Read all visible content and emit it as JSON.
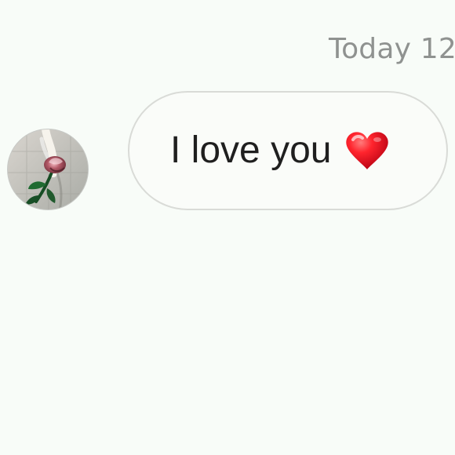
{
  "chat": {
    "timestamp": "Today 12",
    "messages": [
      {
        "text": "I love you",
        "reaction_icon": "red-heart-icon",
        "avatar_icon": "rose-avatar-icon"
      }
    ]
  },
  "colors": {
    "background": "#f8fcf8",
    "timestamp": "#8f9290",
    "bubble_border": "#d9dbd7",
    "bubble_fill": "#fafcf9",
    "message_text": "#1f1f1f",
    "heart_red": "#e01b24"
  }
}
